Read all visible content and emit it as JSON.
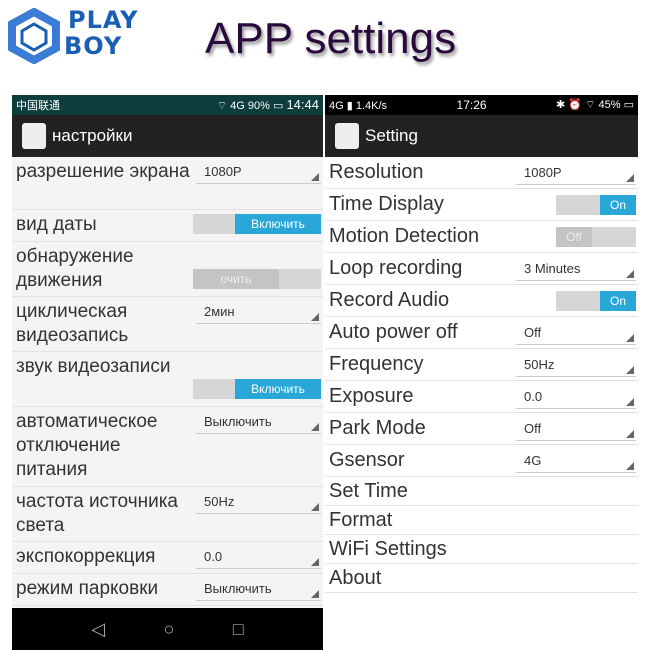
{
  "brand": {
    "line1": "PLAY",
    "line2": "BOY",
    "color": "#1a5fb4"
  },
  "title": "APP settings",
  "left": {
    "status": {
      "carrier": "中国联通",
      "network": "4G",
      "battery": "90%",
      "time": "14:44"
    },
    "toolbar_title": "настройки",
    "rows": [
      {
        "label": "разрешение экрана",
        "type": "select",
        "value": "1080P"
      },
      {
        "label": "вид даты",
        "type": "toggle",
        "value": "Включить",
        "state": "on"
      },
      {
        "label": "обнаружение движения",
        "type": "toggle",
        "value": "очить",
        "state": "off"
      },
      {
        "label": "циклическая видеозапись",
        "type": "select",
        "value": "2мин"
      },
      {
        "label": "звук видеозаписи",
        "type": "toggle",
        "value": "Включить",
        "state": "on"
      },
      {
        "label": "автоматическое отключение питания",
        "type": "select",
        "value": "Выключить"
      },
      {
        "label": "частота источника света",
        "type": "select",
        "value": "50Hz"
      },
      {
        "label": "экспокоррекция",
        "type": "select",
        "value": "0.0"
      },
      {
        "label": "режим парковки",
        "type": "select",
        "value": "Выключить"
      }
    ],
    "nav": [
      "◁",
      "○",
      "□"
    ]
  },
  "right": {
    "status": {
      "network": "4G",
      "speed": "1.4K/s",
      "time": "17:26",
      "battery": "45%"
    },
    "toolbar_title": "Setting",
    "rows": [
      {
        "label": "Resolution",
        "type": "select",
        "value": "1080P"
      },
      {
        "label": "Time Display",
        "type": "toggle",
        "value": "On",
        "state": "on"
      },
      {
        "label": "Motion Detection",
        "type": "toggle",
        "value": "Off",
        "state": "off"
      },
      {
        "label": "Loop recording",
        "type": "select",
        "value": "3 Minutes"
      },
      {
        "label": "Record Audio",
        "type": "toggle",
        "value": "On",
        "state": "on"
      },
      {
        "label": "Auto power off",
        "type": "select",
        "value": "Off"
      },
      {
        "label": "Frequency",
        "type": "select",
        "value": "50Hz"
      },
      {
        "label": "Exposure",
        "type": "select",
        "value": "0.0"
      },
      {
        "label": "Park Mode",
        "type": "select",
        "value": "Off"
      },
      {
        "label": "Gsensor",
        "type": "select",
        "value": "4G"
      },
      {
        "label": "Set Time",
        "type": "link"
      },
      {
        "label": "Format",
        "type": "link"
      },
      {
        "label": "WiFi Settings",
        "type": "link"
      },
      {
        "label": "About",
        "type": "link"
      }
    ]
  },
  "colors": {
    "accent": "#2aa7d9",
    "toolbar": "#222222"
  }
}
